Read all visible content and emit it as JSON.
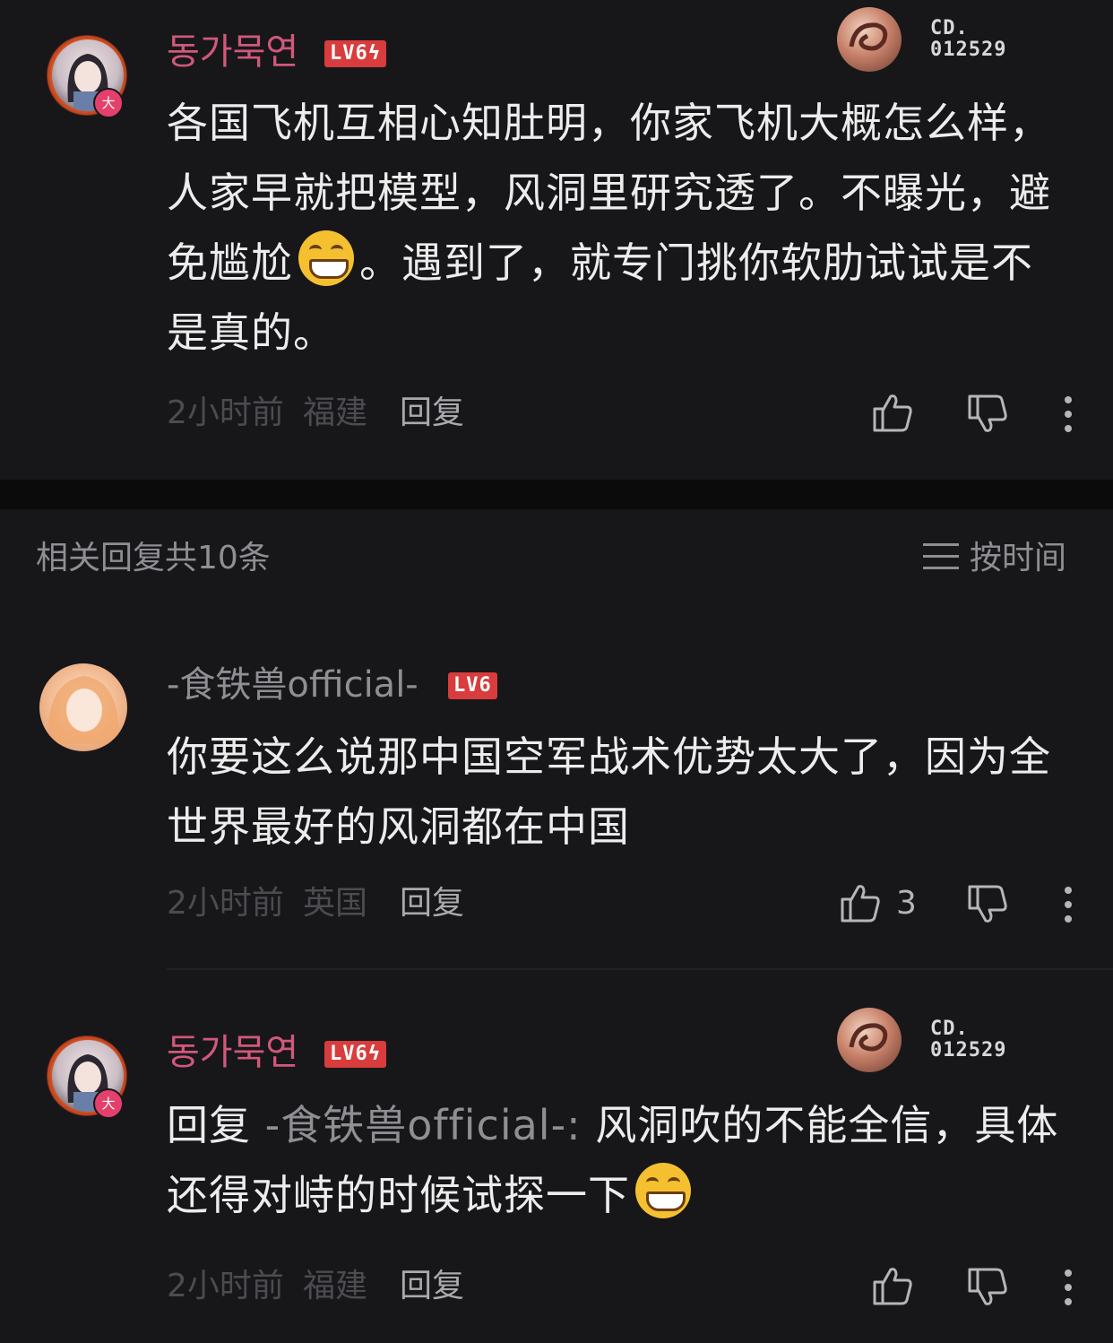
{
  "main_comment": {
    "username": "동가묵연",
    "level": "LV6",
    "avatar_badge": "大",
    "medal_code": [
      "CD.",
      "012529"
    ],
    "text_parts": [
      "各国飞机互相心知肚明，你家飞机大概怎么样，人家早就把模型，风洞里研究透了。不曝光，避免尴尬",
      "。遇到了，就专门挑你软肋试试是不是真的。"
    ],
    "emoji": "grinning-emoji",
    "time": "2小时前",
    "location": "福建",
    "reply_label": "回复"
  },
  "replies_header": {
    "title": "相关回复共10条",
    "sort_label": "按时间",
    "sort_icon": "list-icon"
  },
  "replies": [
    {
      "username": "-食铁兽official-",
      "level": "LV6",
      "text": "你要这么说那中国空军战术优势太大了，因为全世界最好的风洞都在中国",
      "time": "2小时前",
      "location": "英国",
      "reply_label": "回复",
      "likes": "3"
    },
    {
      "username": "동가묵연",
      "level": "LV6",
      "avatar_badge": "大",
      "medal_code": [
        "CD.",
        "012529"
      ],
      "reply_prefix": "回复",
      "reply_target": "-食铁兽official-:",
      "text": "风洞吹的不能全信，具体还得对峙的时候试探一下",
      "emoji": "grinning-emoji",
      "time": "2小时前",
      "location": "福建",
      "reply_label": "回复"
    }
  ],
  "colors": {
    "background": "#17171a",
    "username_vip": "#d2587a",
    "username_normal": "#8e8e93",
    "level_badge": "#d83c3c"
  }
}
